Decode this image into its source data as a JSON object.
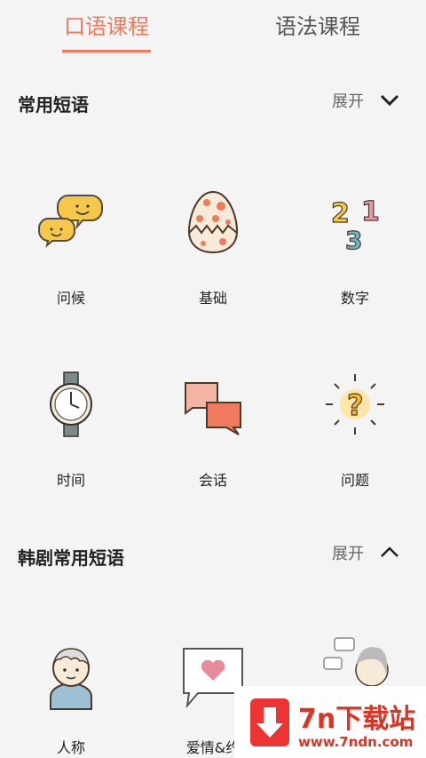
{
  "tabs": {
    "spoken": "口语课程",
    "grammar": "语法课程"
  },
  "sections": [
    {
      "title": "常用短语",
      "expand": "展开",
      "items": [
        {
          "label": "问候",
          "icon": "chat-bubbles-icon"
        },
        {
          "label": "基础",
          "icon": "egg-icon"
        },
        {
          "label": "数字",
          "icon": "numbers-icon"
        },
        {
          "label": "时间",
          "icon": "watch-icon"
        },
        {
          "label": "会话",
          "icon": "conversation-icon"
        },
        {
          "label": "问题",
          "icon": "question-icon"
        }
      ]
    },
    {
      "title": "韩剧常用短语",
      "expand": "展开",
      "items": [
        {
          "label": "人称",
          "icon": "person-icon"
        },
        {
          "label": "爱情&约",
          "icon": "love-chat-icon"
        },
        {
          "label": "",
          "icon": "thinking-girl-icon"
        }
      ]
    }
  ],
  "watermark": {
    "title": "7n下载站",
    "url": "www.7ndn.com"
  },
  "colors": {
    "accent": "#f07a5e",
    "background": "#f4f4f4"
  }
}
